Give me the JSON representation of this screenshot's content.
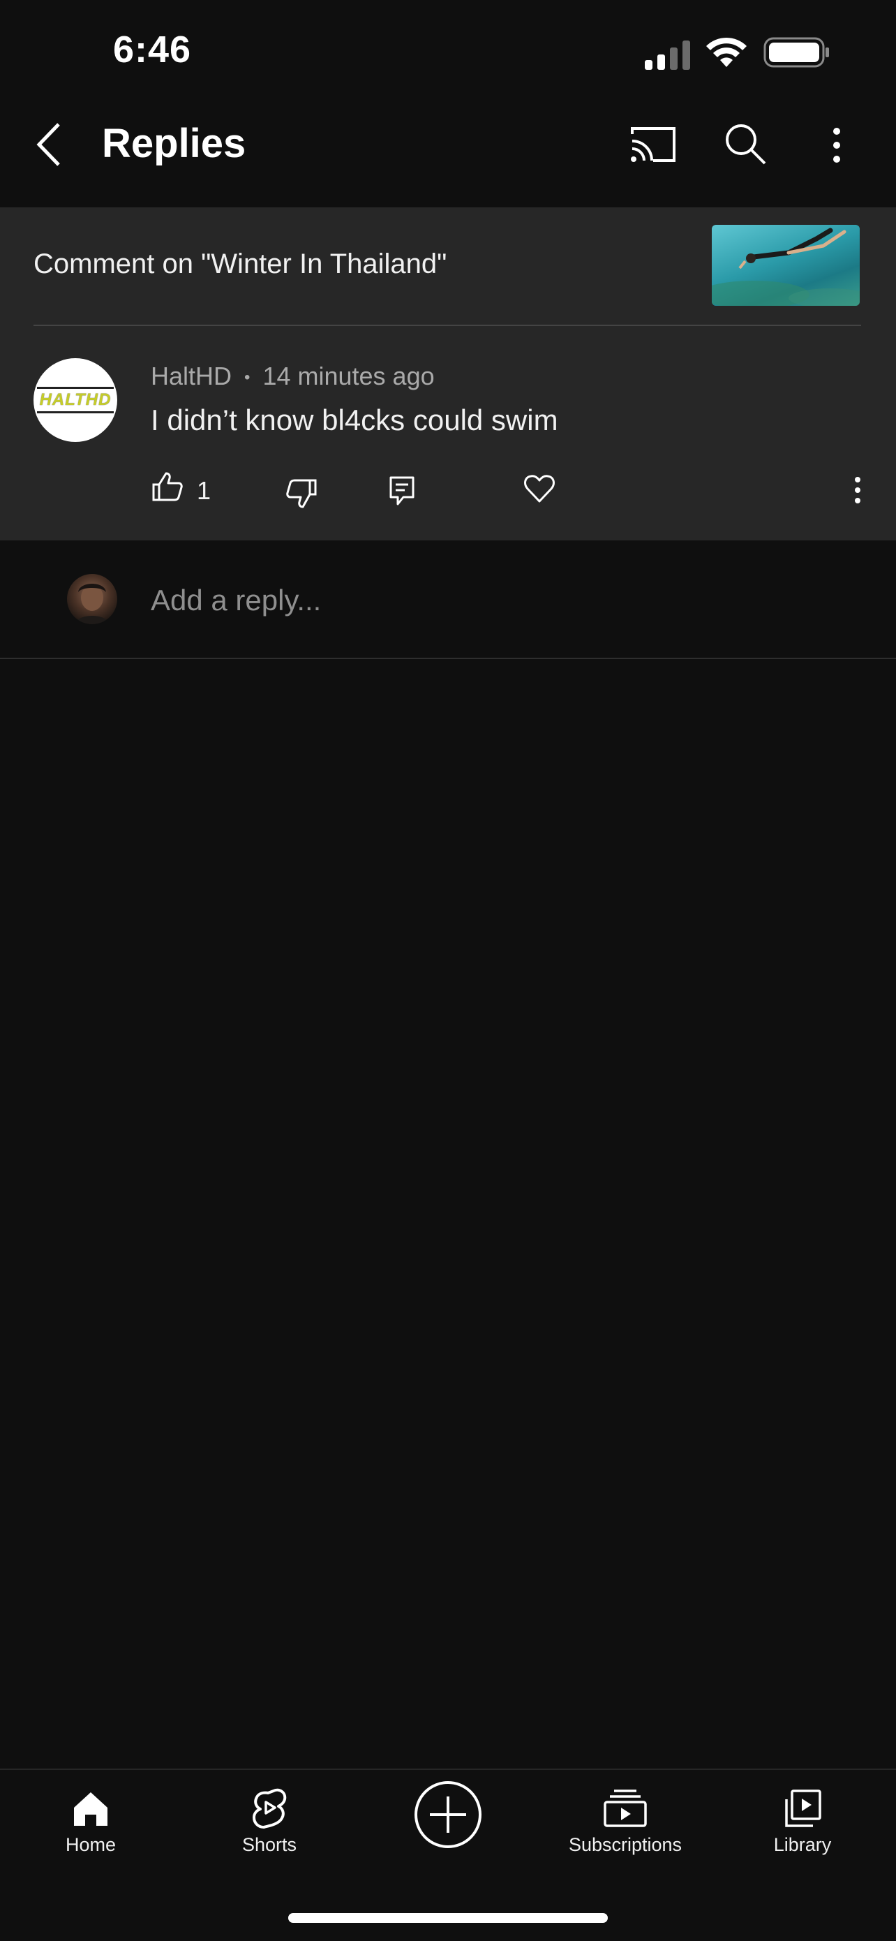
{
  "status_bar": {
    "time": "6:46"
  },
  "header": {
    "title": "Replies"
  },
  "context": {
    "label": "Comment on \"Winter In Thailand\""
  },
  "comment": {
    "author_logo_text": "HALTHD",
    "author": "HaltHD",
    "separator": "•",
    "time_ago": "14 minutes ago",
    "text": "I didn’t know bl4cks could swim",
    "like_count": "1"
  },
  "reply": {
    "placeholder": "Add a reply..."
  },
  "nav": {
    "home": "Home",
    "shorts": "Shorts",
    "subscriptions": "Subscriptions",
    "library": "Library"
  },
  "icons": {
    "back": "chevron-left-icon",
    "cast": "cast-icon",
    "search": "search-icon",
    "more": "more-vert-icon",
    "like": "thumb-up-icon",
    "dislike": "thumb-down-icon",
    "reply": "comment-icon",
    "heart": "heart-icon",
    "create": "add-circle-icon"
  }
}
